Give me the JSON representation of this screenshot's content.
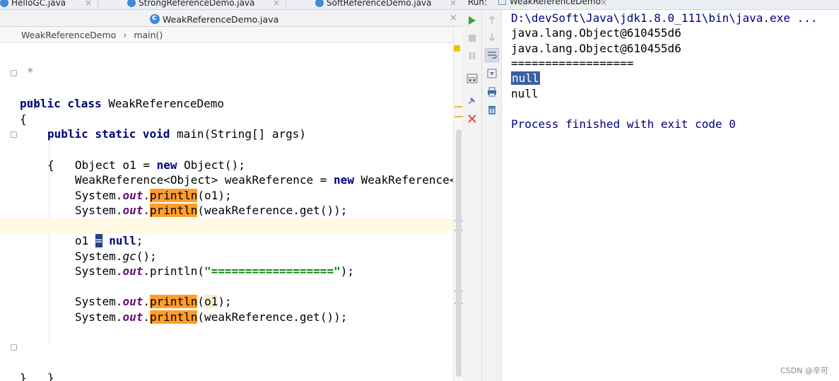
{
  "editor": {
    "tabs": [
      {
        "label": "HelloGC.java"
      },
      {
        "label": "StrongReferenceDemo.java"
      },
      {
        "label": "SoftReferenceDemo.java"
      }
    ],
    "active_tab": "WeakReferenceDemo.java",
    "close_glyph": "×",
    "breadcrumb": {
      "class": "WeakReferenceDemo",
      "separator": "›",
      "method": "main()"
    },
    "code": {
      "l1": "*",
      "l2": "*/",
      "l3_kw": "public class",
      "l3_name": " WeakReferenceDemo",
      "l4": "{",
      "l5_kw": "public static void",
      "l5_rest": " main(String[] args)",
      "l6": "{",
      "l7_a": "Object o1 = ",
      "l7_kw": "new",
      "l7_b": " Object();",
      "l8_a": "WeakReference<Object> weakReference = ",
      "l8_kw": "new",
      "l8_b": " WeakReference<",
      "l9_a": "System.",
      "l9_out": "out",
      "l9_dot": ".",
      "l9_m": "println",
      "l9_b": "(o1);",
      "l10_a": "System.",
      "l10_out": "out",
      "l10_dot": ".",
      "l10_m": "println",
      "l10_b": "(weakReference.get());",
      "l12_a": "o1 ",
      "l12_sel": "=",
      "l12_sp": " ",
      "l12_kw": "null",
      "l12_b": ";",
      "l13_a": "System.",
      "l13_m": "gc",
      "l13_b": "();",
      "l14_a": "System.",
      "l14_out": "out",
      "l14_b": ".println(",
      "l14_str": "\"==================\"",
      "l14_c": ");",
      "l16_a": "System.",
      "l16_out": "out",
      "l16_dot": ".",
      "l16_m": "println",
      "l16_p": "(",
      "l16_o1": "o1",
      "l16_b": ");",
      "l17_a": "System.",
      "l17_out": "out",
      "l17_dot": ".",
      "l17_m": "println",
      "l17_b": "(weakReference.get());",
      "l20": "}",
      "l21": "}"
    }
  },
  "run": {
    "label": "Run:",
    "tab": "WeakReferenceDemo",
    "close_glyph": "×",
    "toolbar_icons": [
      "run-icon",
      "stop-icon",
      "pause-icon",
      "layout-icon",
      "pin-icon",
      "close-icon",
      "up-icon",
      "down-icon",
      "soft-wrap-icon",
      "scroll-end-icon",
      "print-icon",
      "trash-icon"
    ],
    "console": {
      "cmd": "D:\\devSoft\\Java\\jdk1.8.0_111\\bin\\java.exe ...",
      "out1": "java.lang.Object@610455d6",
      "out2": "java.lang.Object@610455d6",
      "sep": "==================",
      "null1": "null",
      "null2": "null",
      "exit": "Process finished with exit code 0"
    }
  },
  "watermark": "CSDN @辛可",
  "colors": {
    "keyword": "#000080",
    "string": "#008000",
    "field": "#660e7a",
    "highlight": "#ff9e2b",
    "selection": "#214283"
  }
}
